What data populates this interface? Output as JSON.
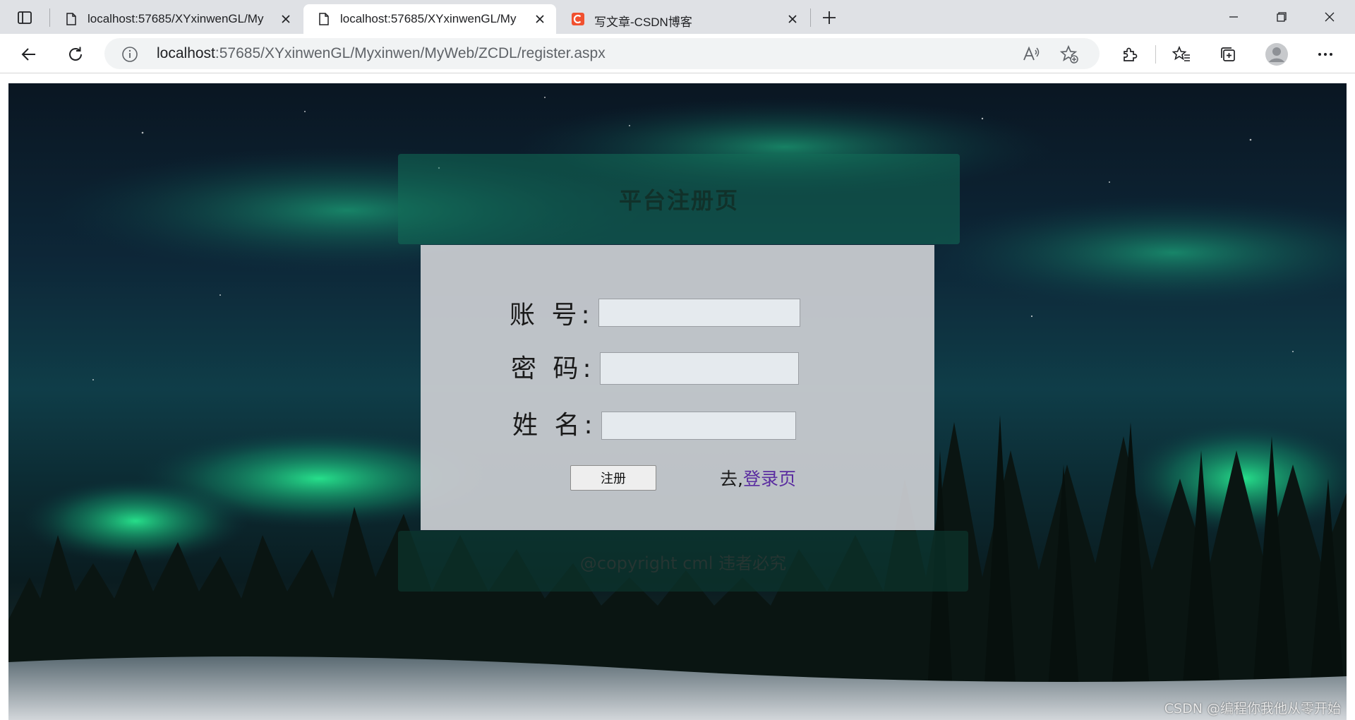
{
  "browser": {
    "tabs": [
      {
        "title": "localhost:57685/XYxinwenGL/My",
        "favicon": "page-icon",
        "active": false
      },
      {
        "title": "localhost:57685/XYxinwenGL/My",
        "favicon": "page-icon",
        "active": true
      },
      {
        "title": "写文章-CSDN博客",
        "favicon": "csdn-icon",
        "active": false
      }
    ],
    "address": {
      "host": "localhost",
      "path": ":57685/XYxinwenGL/Myxinwen/MyWeb/ZCDL/register.aspx"
    }
  },
  "page": {
    "header_title": "平台注册页",
    "form": {
      "account_label": "账 号:",
      "password_label": "密 码:",
      "name_label": "姓 名:",
      "account_value": "",
      "password_value": "",
      "name_value": "",
      "register_label": "注册",
      "goto_prefix": "去,",
      "login_link": "登录页"
    },
    "footer_text": "@copyright cml 违者必究",
    "watermark": "CSDN @编程你我他从零开始"
  },
  "colors": {
    "header_panel": "#126e58",
    "form_panel": "#cdcfd4",
    "footer_panel": "#0c3a30",
    "link": "#5a2ca0"
  }
}
